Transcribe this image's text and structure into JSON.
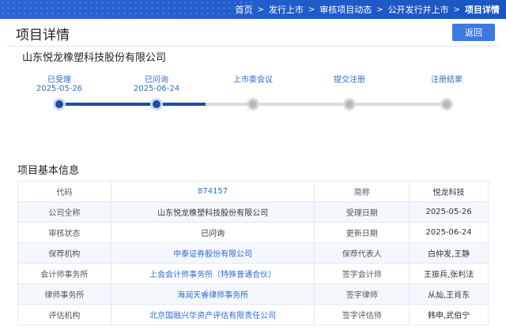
{
  "breadcrumb": {
    "items": [
      "首页",
      "发行上市",
      "审核项目动态",
      "公开发行并上市",
      "项目详情"
    ],
    "separator": ">"
  },
  "header": {
    "title": "项目详情",
    "back_label": "返回"
  },
  "company": {
    "name": "山东悦龙橡塑科技股份有限公司"
  },
  "timeline": {
    "steps": [
      {
        "label": "已受理",
        "date": "2025-05-26",
        "done": true
      },
      {
        "label": "已问询",
        "date": "2025-06-24",
        "done": true
      },
      {
        "label": "上市委会议",
        "date": "",
        "done": false
      },
      {
        "label": "提交注册",
        "date": "",
        "done": false
      },
      {
        "label": "注册结果",
        "date": "",
        "done": false
      }
    ]
  },
  "basic_info": {
    "title": "项目基本信息",
    "rows": [
      {
        "k1": "代码",
        "v1": "874157",
        "k2": "简称",
        "v2": "悦龙科技"
      },
      {
        "k1": "公司全称",
        "v1": "山东悦龙橡塑科技股份有限公司",
        "k2": "受理日期",
        "v2": "2025-05-26"
      },
      {
        "k1": "审核状态",
        "v1": "已问询",
        "k2": "更新日期",
        "v2": "2025-06-24"
      },
      {
        "k1": "保荐机构",
        "v1": "中泰证券股份有限公司",
        "k2": "保荐代表人",
        "v2": "白仲发,王静"
      },
      {
        "k1": "会计师事务所",
        "v1": "上会会计师事务所（特殊普通合伙）",
        "k2": "签字会计师",
        "v2": "王振兵,张利法"
      },
      {
        "k1": "律师事务所",
        "v1": "海润天睿律师事务所",
        "k2": "签字律师",
        "v2": "从灿,王肖东"
      },
      {
        "k1": "评估机构",
        "v1": "北京国融兴华资产评估有限责任公司",
        "k2": "签字评估师",
        "v2": "韩申,武伯宁"
      }
    ]
  },
  "colors": {
    "topbar": "#1f5fcc",
    "accent": "#2e6bd6",
    "progress_done": "#1d4f9c",
    "progress_pending": "#dcdcdc",
    "back_button": "#3d7be0"
  }
}
